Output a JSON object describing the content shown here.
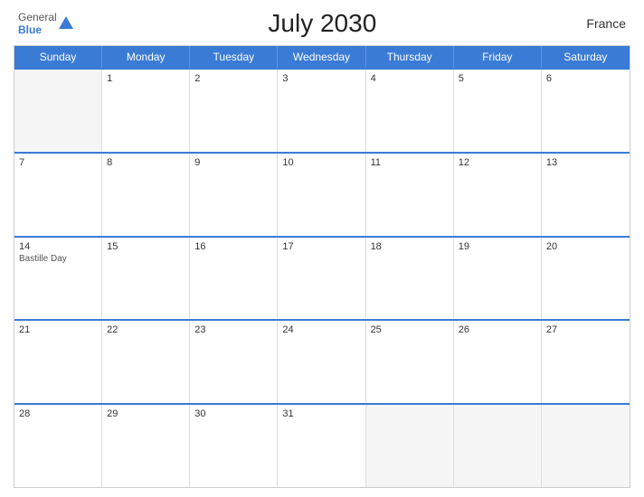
{
  "header": {
    "logo_general": "General",
    "logo_blue": "Blue",
    "title": "July 2030",
    "country": "France"
  },
  "weekdays": [
    "Sunday",
    "Monday",
    "Tuesday",
    "Wednesday",
    "Thursday",
    "Friday",
    "Saturday"
  ],
  "weeks": [
    [
      {
        "day": "",
        "empty": true
      },
      {
        "day": "1",
        "empty": false
      },
      {
        "day": "2",
        "empty": false
      },
      {
        "day": "3",
        "empty": false
      },
      {
        "day": "4",
        "empty": false
      },
      {
        "day": "5",
        "empty": false
      },
      {
        "day": "6",
        "empty": false
      }
    ],
    [
      {
        "day": "7",
        "empty": false
      },
      {
        "day": "8",
        "empty": false
      },
      {
        "day": "9",
        "empty": false
      },
      {
        "day": "10",
        "empty": false
      },
      {
        "day": "11",
        "empty": false
      },
      {
        "day": "12",
        "empty": false
      },
      {
        "day": "13",
        "empty": false
      }
    ],
    [
      {
        "day": "14",
        "empty": false,
        "event": "Bastille Day"
      },
      {
        "day": "15",
        "empty": false
      },
      {
        "day": "16",
        "empty": false
      },
      {
        "day": "17",
        "empty": false
      },
      {
        "day": "18",
        "empty": false
      },
      {
        "day": "19",
        "empty": false
      },
      {
        "day": "20",
        "empty": false
      }
    ],
    [
      {
        "day": "21",
        "empty": false
      },
      {
        "day": "22",
        "empty": false
      },
      {
        "day": "23",
        "empty": false
      },
      {
        "day": "24",
        "empty": false
      },
      {
        "day": "25",
        "empty": false
      },
      {
        "day": "26",
        "empty": false
      },
      {
        "day": "27",
        "empty": false
      }
    ],
    [
      {
        "day": "28",
        "empty": false
      },
      {
        "day": "29",
        "empty": false
      },
      {
        "day": "30",
        "empty": false
      },
      {
        "day": "31",
        "empty": false
      },
      {
        "day": "",
        "empty": true
      },
      {
        "day": "",
        "empty": true
      },
      {
        "day": "",
        "empty": true
      }
    ]
  ]
}
